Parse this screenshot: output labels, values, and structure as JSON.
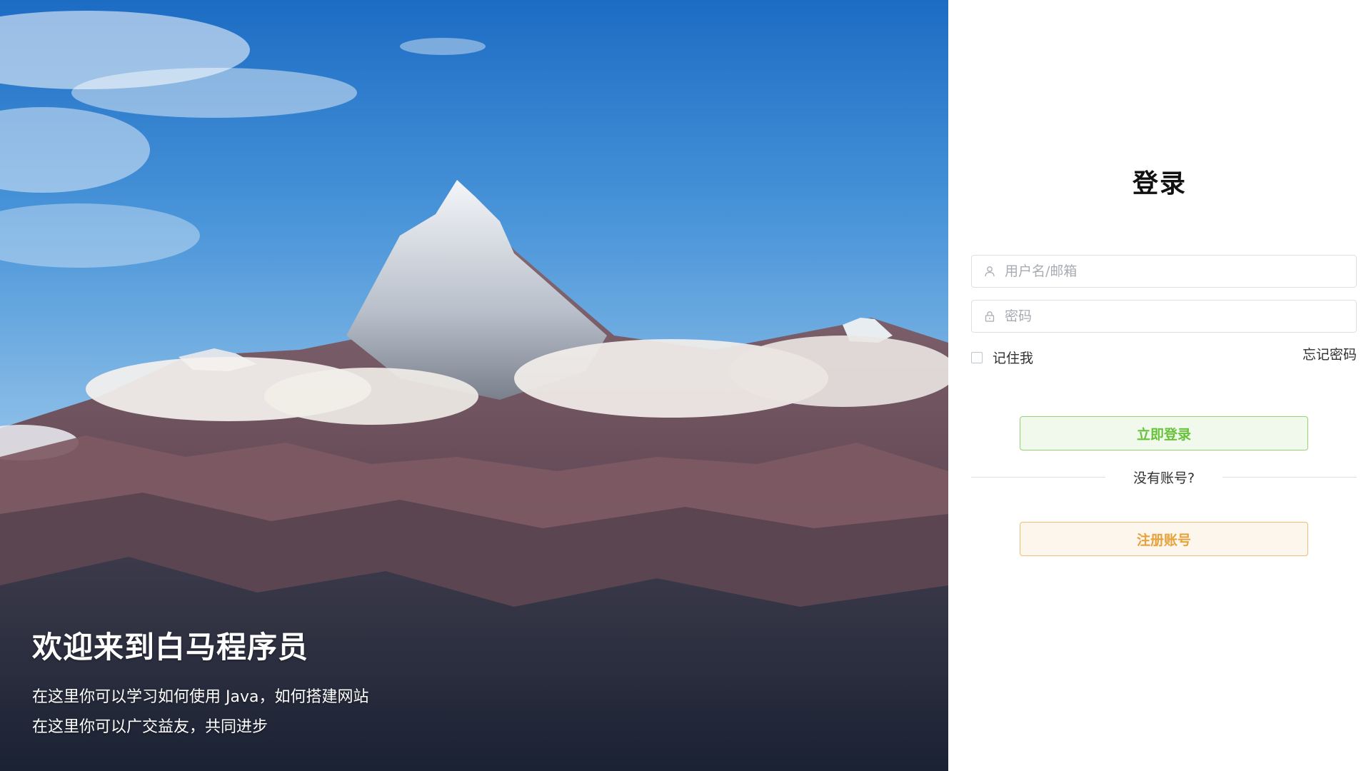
{
  "hero": {
    "title": "欢迎来到白马程序员",
    "line1": "在这里你可以学习如何使用 Java，如何搭建网站",
    "line2": "在这里你可以广交益友，共同进步"
  },
  "login": {
    "title": "登录",
    "username_placeholder": "用户名/邮箱",
    "password_placeholder": "密码",
    "remember_label": "记住我",
    "forgot_label": "忘记密码",
    "login_button": "立即登录",
    "no_account_text": "没有账号?",
    "register_button": "注册账号"
  },
  "icons": {
    "username": "user-icon",
    "password": "lock-icon"
  },
  "colors": {
    "login_button_bg": "#f0f9eb",
    "login_button_border": "#95d475",
    "login_button_text": "#67c23a",
    "register_button_bg": "#fdf6ec",
    "register_button_border": "#eebe77",
    "register_button_text": "#e6a23c"
  }
}
